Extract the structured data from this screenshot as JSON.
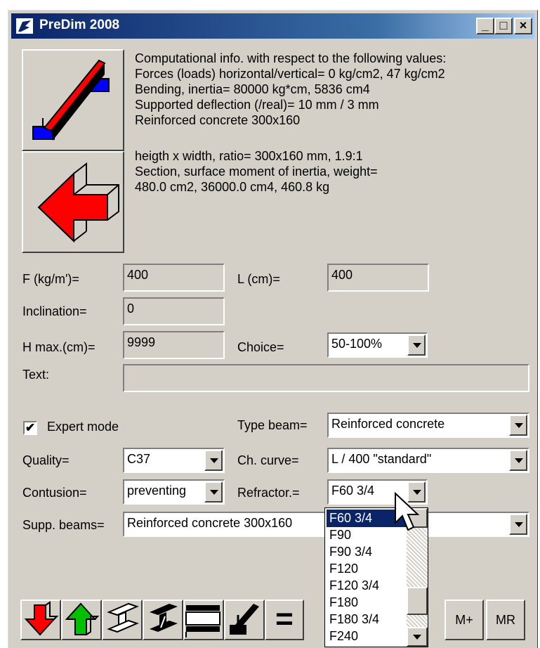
{
  "window": {
    "title": "PreDim 2008",
    "min": "_",
    "max": "□",
    "close": "×"
  },
  "info": {
    "line1": "Computational info. with respect to the following values:",
    "line2": "Forces (loads) horizontal/vertical= 0 kg/cm2, 47 kg/cm2",
    "line3": "Bending, inertia= 80000 kg*cm, 5836 cm4",
    "line4": "Supported deflection (/real)= 10 mm / 3 mm",
    "line5": "Reinforced concrete 300x160",
    "line6": "heigth x width, ratio= 300x160 mm, 1.9:1",
    "line7": "Section, surface moment of inertia, weight=",
    "line8": "480.0 cm2, 36000.0 cm4, 460.8 kg"
  },
  "form": {
    "f_label": "F (kg/m')=",
    "f_value": "400",
    "l_label": "L (cm)=",
    "l_value": "400",
    "incl_label": "Inclination=",
    "incl_value": "0",
    "hmax_label": "H max.(cm)=",
    "hmax_value": "9999",
    "choice_label": "Choice=",
    "choice_value": "50-100%",
    "text_label": "Text:",
    "text_value": "",
    "expert_label": "Expert mode",
    "expert_checked": "✔",
    "type_label": "Type beam=",
    "type_value": "Reinforced concrete",
    "quality_label": "Quality=",
    "quality_value": "C37",
    "curve_label": "Ch. curve=",
    "curve_value": "L / 400 \"standard\"",
    "contusion_label": "Contusion=",
    "contusion_value": "preventing",
    "refractor_label": "Refractor.=",
    "refractor_value": "F60 3/4",
    "supp_label": "Supp. beams=",
    "supp_value": "Reinforced concrete 300x160"
  },
  "dropdown": {
    "options": [
      "F60 3/4",
      "F90",
      "F90 3/4",
      "F120",
      "F120 3/4",
      "F180",
      "F180 3/4",
      "F240"
    ],
    "selected": "F60 3/4"
  },
  "toolbar": {
    "equals": "=",
    "m_plus": "M+",
    "mr": "MR"
  },
  "colors": {
    "accent": "#0a246a",
    "red": "#ff0000",
    "green": "#00c000",
    "blue": "#0000ff"
  }
}
